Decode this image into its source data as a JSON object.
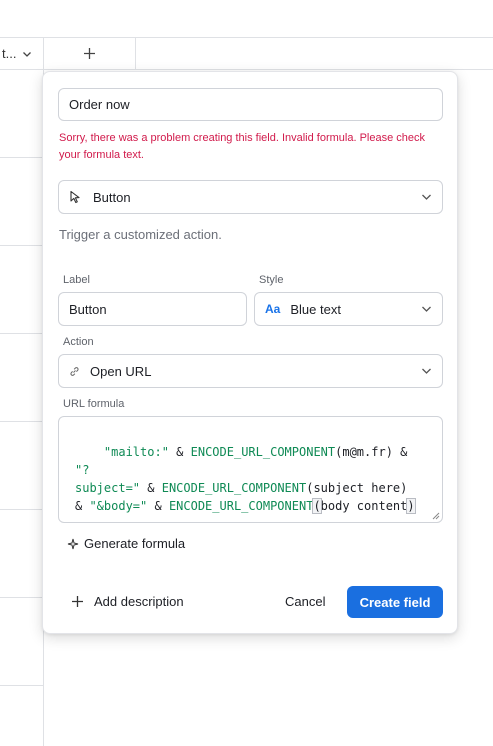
{
  "grid": {
    "column_label": "t...",
    "add_column_icon": "plus-icon"
  },
  "dialog": {
    "field_name": "Order now",
    "error": "Sorry, there was a problem creating this field. Invalid formula. Please check your formula text.",
    "field_type": {
      "icon": "cursor-arrow-icon",
      "label": "Button"
    },
    "type_description": "Trigger a customized action.",
    "label_section": {
      "title": "Label",
      "value": "Button"
    },
    "style_section": {
      "title": "Style",
      "icon_text": "Aa",
      "value": "Blue text"
    },
    "action_section": {
      "title": "Action",
      "icon": "link-icon",
      "value": "Open URL"
    },
    "formula_section": {
      "title": "URL formula",
      "tokens": [
        {
          "t": "\"mailto:\"",
          "k": "str"
        },
        {
          "t": " & ",
          "k": "op"
        },
        {
          "t": "ENCODE_URL_COMPONENT",
          "k": "fn"
        },
        {
          "t": "(m@m.fr)",
          "k": "op"
        },
        {
          "t": " & ",
          "k": "op"
        },
        {
          "t": "\"?\nsubject=\"",
          "k": "str"
        },
        {
          "t": " & ",
          "k": "op"
        },
        {
          "t": "ENCODE_URL_COMPONENT",
          "k": "fn"
        },
        {
          "t": "(subject here)\n& ",
          "k": "op"
        },
        {
          "t": "\"&body=\"",
          "k": "str"
        },
        {
          "t": " & ",
          "k": "op"
        },
        {
          "t": "ENCODE_URL_COMPONENT",
          "k": "fn"
        },
        {
          "t": "(",
          "k": "hl"
        },
        {
          "t": "body content",
          "k": "op"
        },
        {
          "t": ")",
          "k": "hl"
        }
      ]
    },
    "generate_formula": "Generate formula",
    "add_description": "Add description",
    "cancel": "Cancel",
    "create": "Create field",
    "accent_color": "#1a6fe0",
    "error_color": "#d11a4b"
  }
}
